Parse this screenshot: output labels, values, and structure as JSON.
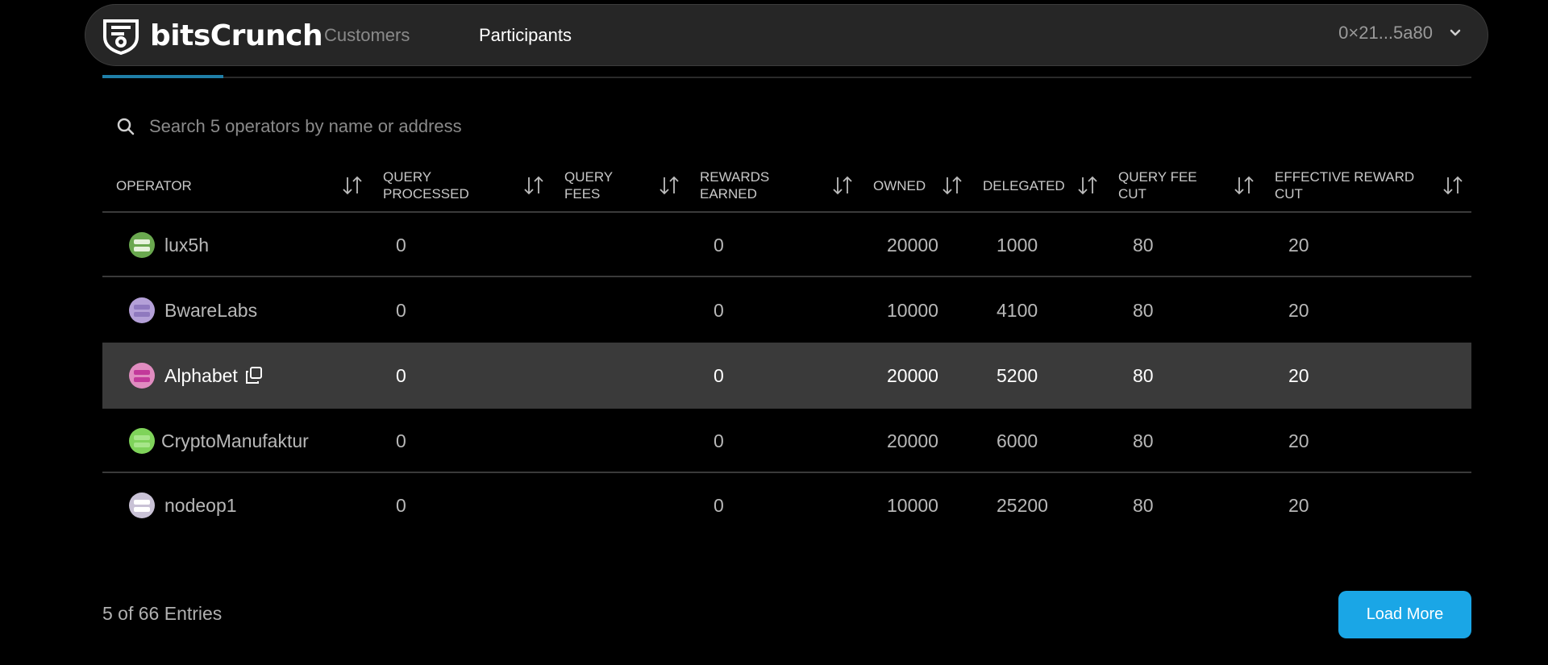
{
  "header": {
    "brand": "bitsCrunch",
    "nav": [
      {
        "label": "Customers",
        "active": false
      },
      {
        "label": "Participants",
        "active": true
      }
    ],
    "wallet_address": "0×21...5a80"
  },
  "search": {
    "placeholder": "Search 5 operators by name or address",
    "value": ""
  },
  "table": {
    "columns": [
      "OPERATOR",
      "QUERY PROCESSED",
      "QUERY FEES",
      "REWARDS EARNED",
      "OWNED",
      "DELEGATED",
      "QUERY FEE CUT",
      "EFFECTIVE REWARD CUT"
    ],
    "rows": [
      {
        "operator": "lux5h",
        "query_processed": "0",
        "query_fees": "",
        "rewards_earned": "0",
        "owned": "20000",
        "delegated": "1000",
        "query_fee_cut": "80",
        "effective_reward_cut": "20",
        "avatar_color": "#6aa84f",
        "avatar_accent": "#e6f2dc"
      },
      {
        "operator": "BwareLabs",
        "query_processed": "0",
        "query_fees": "",
        "rewards_earned": "0",
        "owned": "10000",
        "delegated": "4100",
        "query_fee_cut": "80",
        "effective_reward_cut": "20",
        "avatar_color": "#b4a0d8",
        "avatar_accent": "#8f79bf"
      },
      {
        "operator": "Alphabet",
        "query_processed": "0",
        "query_fees": "",
        "rewards_earned": "0",
        "owned": "20000",
        "delegated": "5200",
        "query_fee_cut": "80",
        "effective_reward_cut": "20",
        "avatar_color": "#e08cc0",
        "avatar_accent": "#c2399a"
      },
      {
        "operator": "CryptoManufaktur",
        "query_processed": "0",
        "query_fees": "",
        "rewards_earned": "0",
        "owned": "20000",
        "delegated": "6000",
        "query_fee_cut": "80",
        "effective_reward_cut": "20",
        "avatar_color": "#7fd35a",
        "avatar_accent": "#a7e68a"
      },
      {
        "operator": "nodeop1",
        "query_processed": "0",
        "query_fees": "",
        "rewards_earned": "0",
        "owned": "10000",
        "delegated": "25200",
        "query_fee_cut": "80",
        "effective_reward_cut": "20",
        "avatar_color": "#c9c2d6",
        "avatar_accent": "#ffffff"
      }
    ],
    "highlighted_row": 2
  },
  "footer": {
    "entries_text": "5 of 66 Entries",
    "load_more_label": "Load More"
  },
  "colors": {
    "accent": "#1aa6e6",
    "tab_underline": "#1f7fa8",
    "row_highlight": "#3a3a3a"
  }
}
